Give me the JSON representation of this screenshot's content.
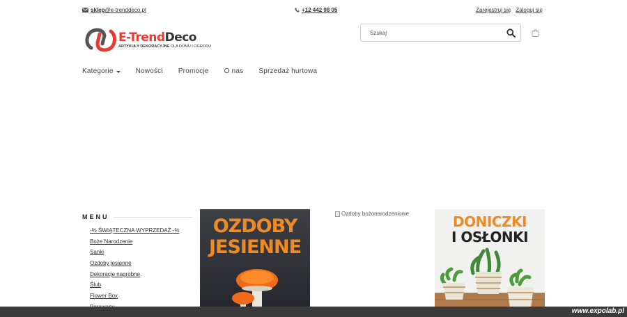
{
  "topbar": {
    "email_user": "sklep",
    "email_domain": "@e-trenddeco.pl",
    "phone": "+12 442 98 05",
    "register": "Zarejestruj się",
    "login": "Zaloguj się"
  },
  "logo": {
    "word_accent": "E-Trend",
    "word_rest": "Deco",
    "tagline_bold": "ARTYKUŁY DEKORACYJNE",
    "tagline_rest": " DLA DOMU I OGRODU"
  },
  "search": {
    "placeholder": "Szukaj"
  },
  "nav": {
    "items": [
      "Kategorie",
      "Nowości",
      "Promocje",
      "O nas",
      "Sprzedaż hurtowa"
    ]
  },
  "menu": {
    "title": "MENU",
    "items": [
      "-% ŚWIĄTECZNA WYPRZEDAŻ -%",
      "Boże Narodzenie",
      "Sanki",
      "Ozdoby jesienne",
      "Dekoracje nagrobne",
      "Ślub",
      "Flower Box",
      "Parawany"
    ]
  },
  "banners": {
    "autumn_line1": "OZDOBY",
    "autumn_line2": "JESIENNE",
    "christmas_alt": "Ozdoby bożonarodzeniowe",
    "pots_line1": "DONICZKI",
    "pots_line2": "I OSŁONKI"
  },
  "watermark": "www.expolab.pl",
  "colors": {
    "brand_red": "#e63a33",
    "accent_orange": "#f08a24"
  }
}
